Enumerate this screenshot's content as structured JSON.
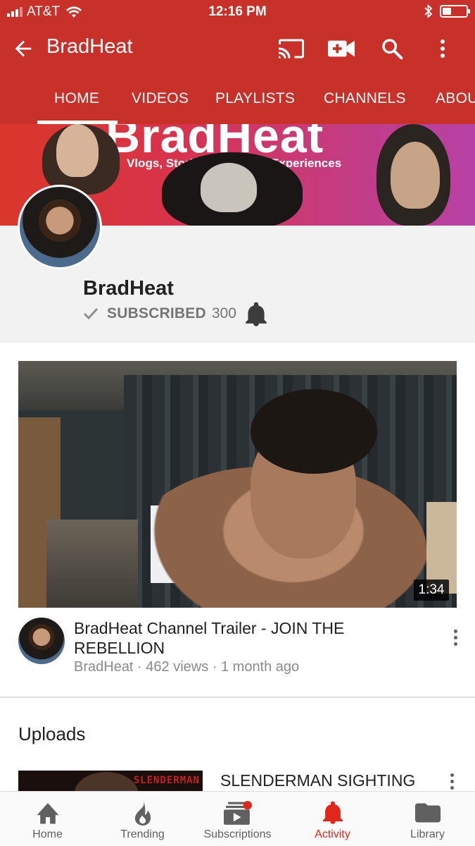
{
  "status_bar": {
    "carrier": "AT&T",
    "time": "12:16 PM",
    "battery_level": 0.35
  },
  "app_bar": {
    "title": "BradHeat",
    "icons": [
      "back-arrow-icon",
      "cast-icon",
      "video-camera-add-icon",
      "search-icon",
      "more-vert-icon"
    ]
  },
  "tabs": [
    {
      "label": "HOME",
      "selected": true
    },
    {
      "label": "VIDEOS",
      "selected": false
    },
    {
      "label": "PLAYLISTS",
      "selected": false
    },
    {
      "label": "CHANNELS",
      "selected": false
    },
    {
      "label": "ABOU",
      "selected": false
    }
  ],
  "banner": {
    "title": "BradHeat",
    "tagline": "Vlogs, Stories, and other Experiences"
  },
  "channel": {
    "name": "BradHeat",
    "subscribed_label": "SUBSCRIBED",
    "subscriber_count": "300"
  },
  "featured_video": {
    "title": "BradHeat Channel Trailer - JOIN THE REBELLION",
    "meta": "BradHeat · 462 views · 1 month ago",
    "duration": "1:34"
  },
  "uploads": {
    "heading": "Uploads",
    "items": [
      {
        "title": "SLENDERMAN SIGHTING",
        "thumb_text": "SLENDERMAN"
      }
    ]
  },
  "bottom_nav": [
    {
      "label": "Home",
      "icon": "home-icon",
      "active": false
    },
    {
      "label": "Trending",
      "icon": "flame-icon",
      "active": false
    },
    {
      "label": "Subscriptions",
      "icon": "subscriptions-icon",
      "active": false,
      "badge": true
    },
    {
      "label": "Activity",
      "icon": "bell-icon",
      "active": true
    },
    {
      "label": "Library",
      "icon": "folder-icon",
      "active": false
    }
  ],
  "colors": {
    "brand_red": "#c8302a",
    "active_red": "#e0271c"
  }
}
